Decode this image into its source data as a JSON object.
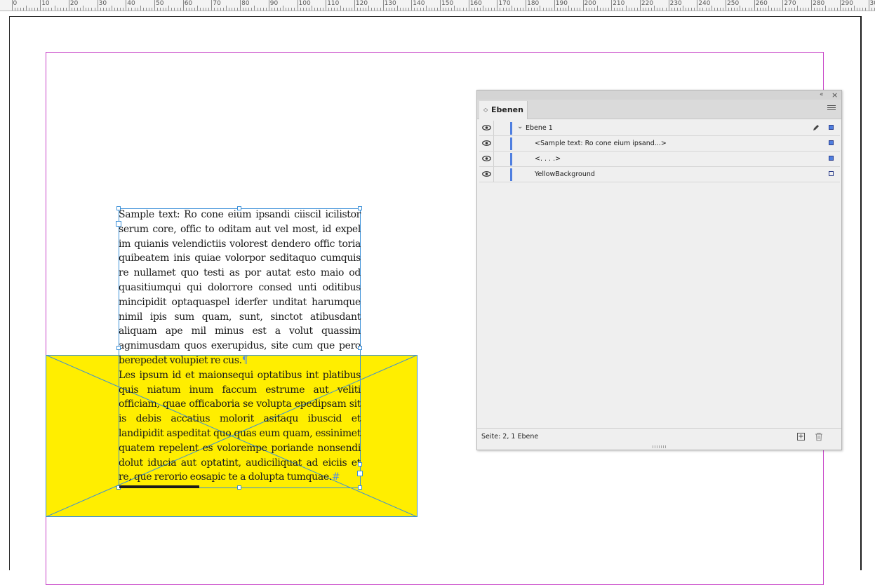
{
  "ruler": {
    "labels": [
      "0",
      "10",
      "20",
      "30",
      "40",
      "50",
      "60",
      "70",
      "80",
      "90",
      "100",
      "110",
      "120",
      "130",
      "140",
      "150",
      "160",
      "170",
      "180",
      "190",
      "200",
      "210",
      "220",
      "230",
      "240",
      "250",
      "260",
      "270",
      "280",
      "290",
      "300"
    ]
  },
  "document": {
    "text_frame": {
      "paragraph1": "Sample text: Ro cone eium ipsandi ciiscil icilistor serum core, offic to oditam aut vel most, id expel im quianis velendictiis volorest dendero offic toria quibeatem inis quiae volorpor seditaquo cumquis re nullamet quo testi as por autat esto maio od quasitiumqui qui dolorrore consed unti oditibus mincipidit optaquaspel iderfer unditat harumque nimil ipis sum quam, sunt, sinctot atibusdant aliquam ape mil minus est a volut quassim agnimusdam quos exerupidus, site cum que pero berepedet volupiet re cus.",
      "pilcrow": "¶",
      "paragraph2": "Les ipsum id et maionsequi optatibus int platibus quis niatum inum faccum estrume aut veliti officiam, quae officaboria se volupta epedipsam sit is debis accatius molorit asitaqu ibuscid et landipidit aspeditat quo quas eum quam, essinimet quatem repelent es volorempe poriande nonsendi dolut iducia aut optatint, audiciliquat ad eiciis et re, que rerorio eosapic te a dolupta tumquae.",
      "end_mark": "#"
    },
    "yellow_color": "#ffee00",
    "margin_color": "#c846c8",
    "frame_color": "#3a8fd8"
  },
  "layers_panel": {
    "collapse_label": "«",
    "close_label": "×",
    "tab_arrows": "◇",
    "tab_title": "Ebenen",
    "layers": [
      {
        "name": "Ebene 1",
        "chevron": "v",
        "has_pen": true,
        "square_filled": true
      },
      {
        "name": "<Sample text: Ro cone eium ipsand...>",
        "has_pen": false,
        "square_filled": true
      },
      {
        "name": "<. . . .>",
        "has_pen": false,
        "square_filled": true
      },
      {
        "name": "YellowBackground",
        "has_pen": false,
        "square_filled": false
      }
    ],
    "footer_text": "Seite: 2, 1 Ebene",
    "new_layer_label": "+",
    "layer_color": "#4f7fe0"
  }
}
